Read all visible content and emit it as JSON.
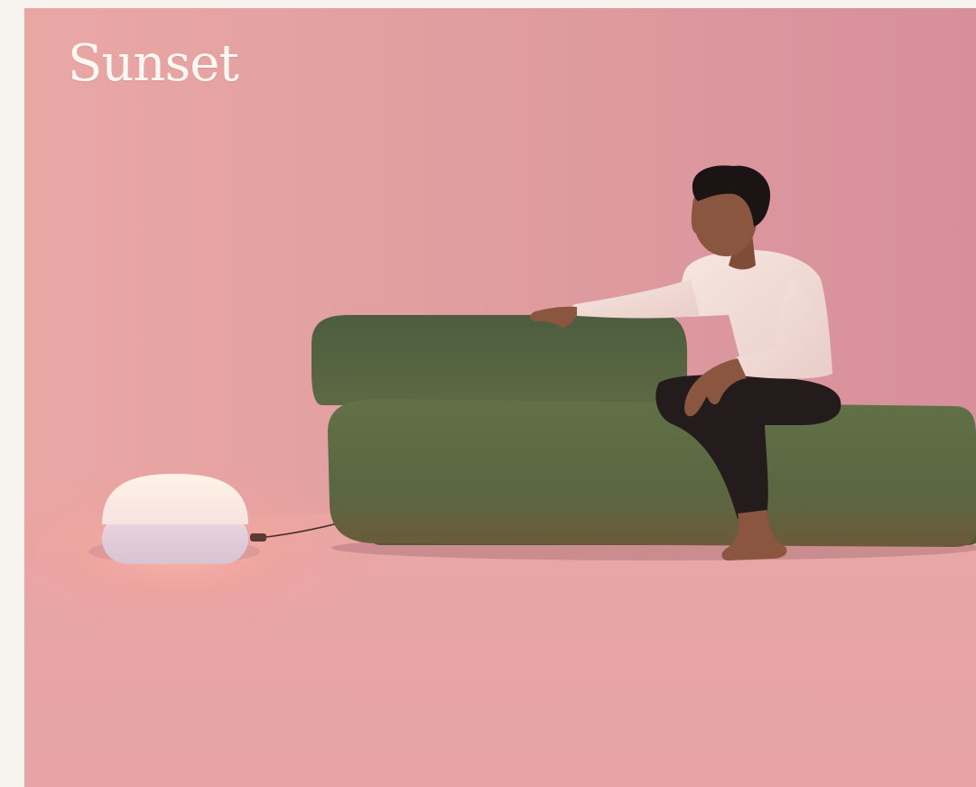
{
  "hero": {
    "title": "Sunset",
    "colors": {
      "backdrop": "#e3a2a1",
      "floor": "#e9a6a5",
      "sofa": "#5c6a45",
      "sweater": "#f2dcd6",
      "lamp_glow": "#fff0e6",
      "page_border": "#f6f3ee"
    }
  }
}
